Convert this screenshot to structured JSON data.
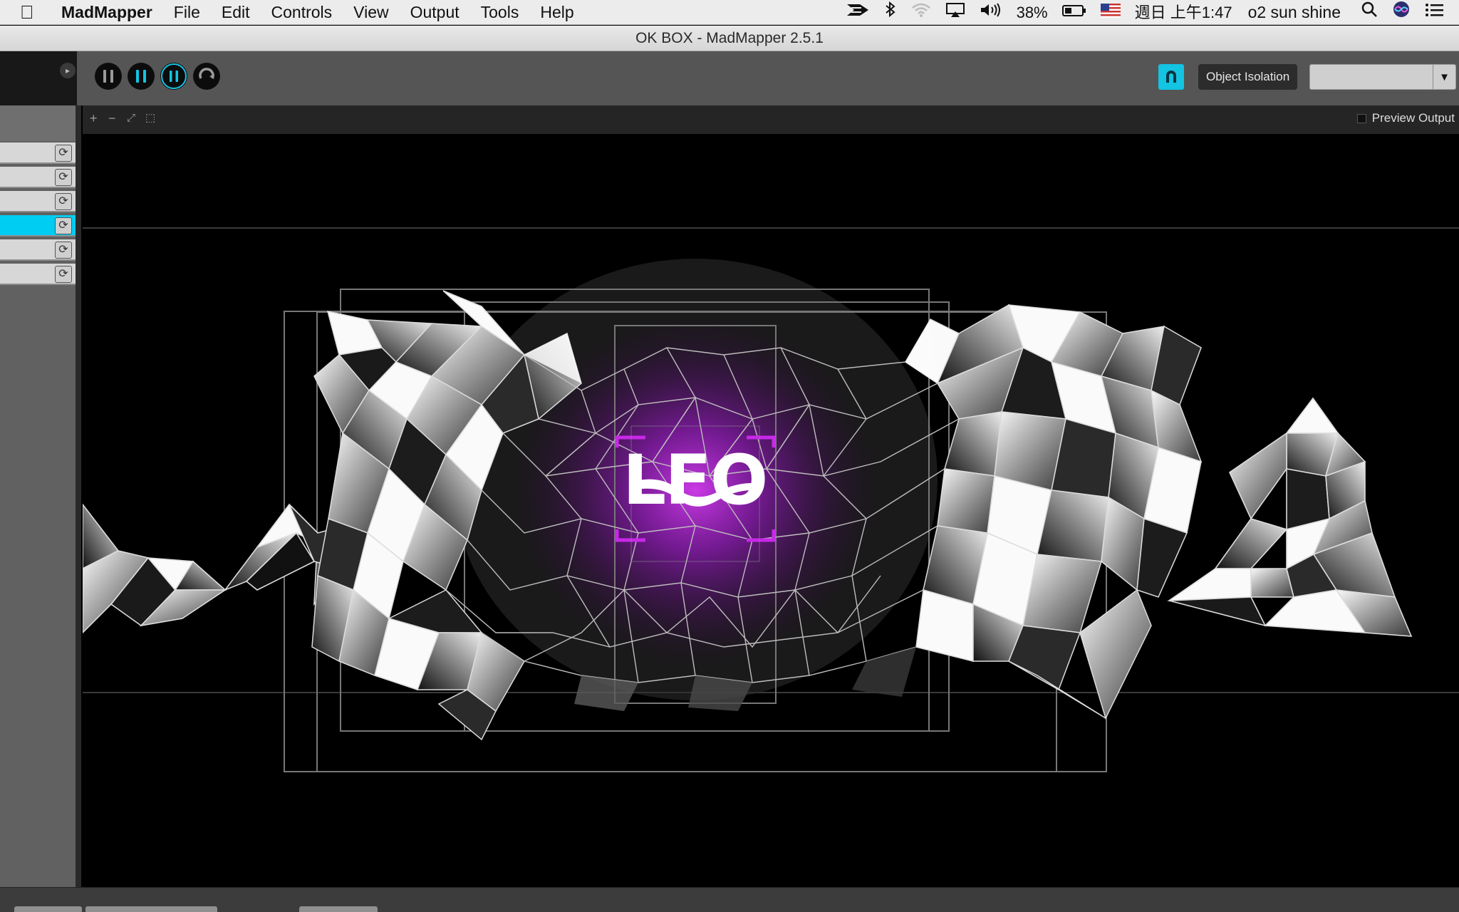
{
  "menubar": {
    "app_name": "MadMapper",
    "menus": [
      "File",
      "Edit",
      "Controls",
      "View",
      "Output",
      "Tools",
      "Help"
    ],
    "battery_percent": "38%",
    "clock": "週日 上午1:47",
    "user": "o2 sun shine"
  },
  "window": {
    "title": "OK BOX - MadMapper 2.5.1"
  },
  "toolbar": {
    "object_isolation_label": "Object Isolation",
    "object_isolation_value": ""
  },
  "viewport": {
    "tools": [
      "+",
      "−",
      "⤢",
      "⬚"
    ],
    "preview_output_label": "Preview Output",
    "overlay_text": "LFO"
  },
  "layers": {
    "count": 6,
    "selected_index": 3
  },
  "colors": {
    "accent": "#00CDF2",
    "glow": "#B020E0",
    "bracket": "#C828E8"
  }
}
